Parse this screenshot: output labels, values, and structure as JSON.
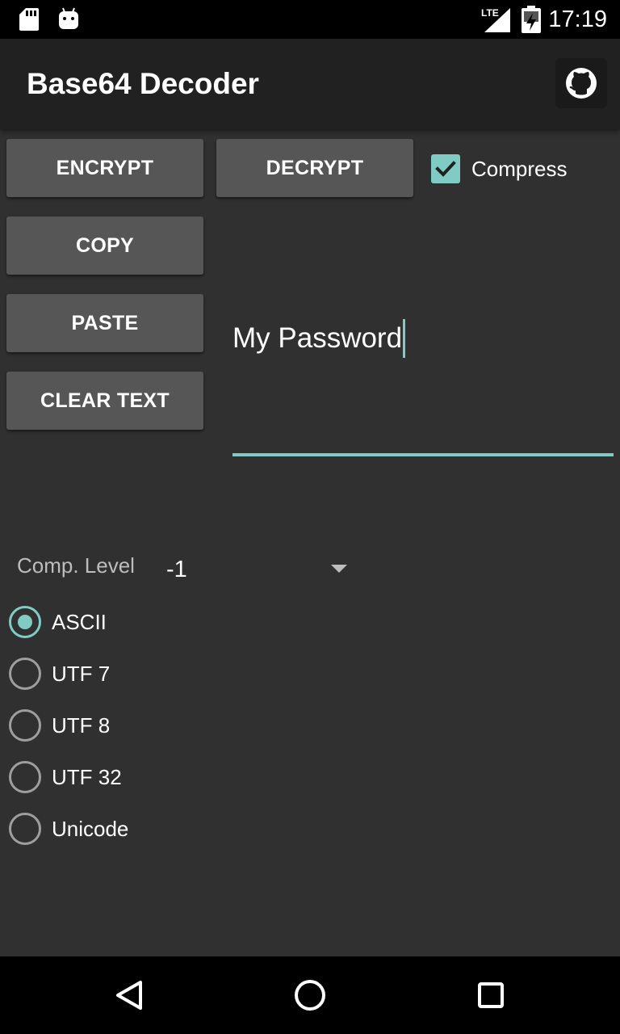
{
  "status_bar": {
    "time": "17:19",
    "network": "LTE",
    "icons": [
      "sd-card-icon",
      "android-icon",
      "signal-icon",
      "battery-icon"
    ]
  },
  "app_bar": {
    "title": "Base64 Decoder",
    "action_icon": "github-icon"
  },
  "buttons": {
    "encrypt": "ENCRYPT",
    "decrypt": "DECRYPT",
    "copy": "COPY",
    "paste": "PASTE",
    "clear": "CLEAR TEXT"
  },
  "compress": {
    "label": "Compress",
    "checked": true
  },
  "text_input": {
    "value": "My Password"
  },
  "compression_level": {
    "label": "Comp. Level",
    "selected": "-1"
  },
  "encodings": [
    {
      "label": "ASCII",
      "checked": true
    },
    {
      "label": "UTF 7",
      "checked": false
    },
    {
      "label": "UTF 8",
      "checked": false
    },
    {
      "label": "UTF 32",
      "checked": false
    },
    {
      "label": "Unicode",
      "checked": false
    }
  ],
  "nav_bar": {
    "icons": [
      "back-icon",
      "home-icon",
      "recents-icon"
    ]
  },
  "colors": {
    "accent": "#80cbc4",
    "background": "#303030",
    "app_bar": "#212121",
    "button": "#565656"
  }
}
